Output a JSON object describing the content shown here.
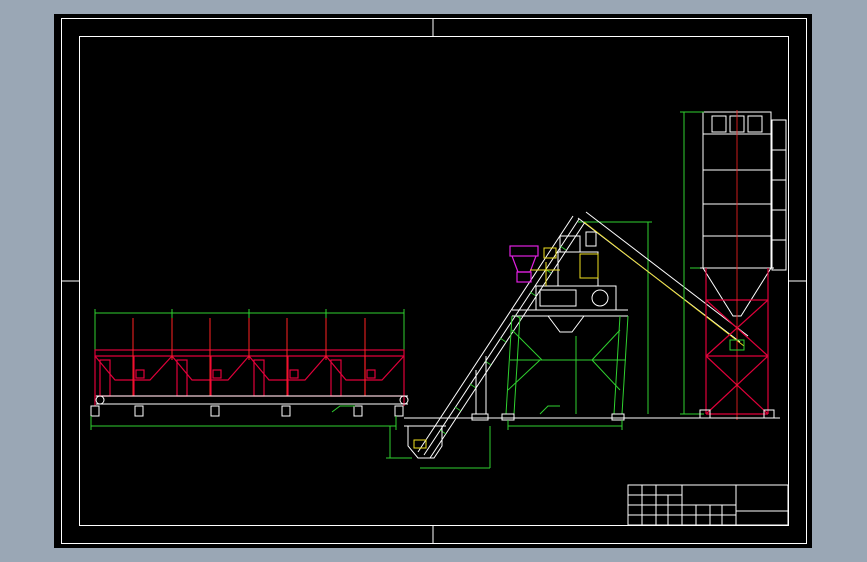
{
  "app": {
    "background_color": "#9aa7b5",
    "viewport_color": "#000000"
  },
  "drawing": {
    "colors": {
      "frame": "#ffffff",
      "hopper_frame": "#e0003a",
      "dimension": "#2fd02f",
      "center_line": "#ff2222",
      "outline": "#ffffff",
      "conveyor": "#ffffff",
      "mixer_hopper": "#e020e0",
      "mixer_detail": "#f0e020",
      "silo": "#ffffff",
      "annotation": "#00c8ff"
    },
    "title_block": {
      "title": "",
      "cells": []
    }
  }
}
